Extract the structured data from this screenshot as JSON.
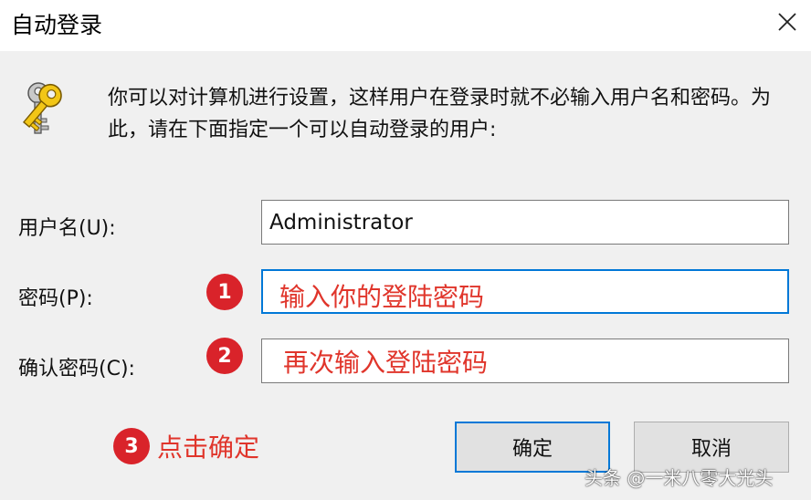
{
  "window": {
    "title": "自动登录",
    "close_icon": "close-icon"
  },
  "description": "你可以对计算机进行设置，这样用户在登录时就不必输入用户名和密码。为此，请在下面指定一个可以自动登录的用户:",
  "fields": {
    "username": {
      "label": "用户名(U):",
      "value": "Administrator"
    },
    "password": {
      "label": "密码(P):",
      "value": ""
    },
    "confirm": {
      "label": "确认密码(C):",
      "value": ""
    }
  },
  "annotations": {
    "step1": {
      "number": "1",
      "text": "输入你的登陆密码"
    },
    "step2": {
      "number": "2",
      "text": "再次输入登陆密码"
    },
    "step3": {
      "number": "3",
      "text": "点击确定"
    }
  },
  "buttons": {
    "ok": "确定",
    "cancel": "取消"
  },
  "watermark": "头条 @一米八零大光头",
  "colors": {
    "annotation": "#e0352b",
    "badge": "#d9232a",
    "focus": "#0078d7",
    "client_bg": "#f0f0f0"
  }
}
